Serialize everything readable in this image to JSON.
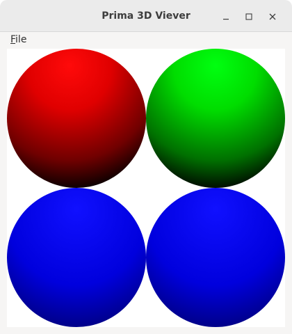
{
  "window": {
    "title": "Prima 3D Viever",
    "controls": {
      "minimize_icon": "minimize-icon",
      "maximize_icon": "maximize-icon",
      "close_icon": "close-icon"
    }
  },
  "menubar": {
    "items": [
      {
        "label": "File",
        "mnemonic": "F",
        "rest": "ile"
      }
    ]
  },
  "viewport": {
    "background": "#ffffff",
    "spheres": [
      {
        "name": "red-sphere",
        "color": "#ff0000"
      },
      {
        "name": "green-sphere",
        "color": "#00ff00"
      },
      {
        "name": "blue-sphere-bottom-left",
        "color": "#0000ff"
      },
      {
        "name": "blue-sphere-bottom-right",
        "color": "#0000ff"
      }
    ]
  }
}
